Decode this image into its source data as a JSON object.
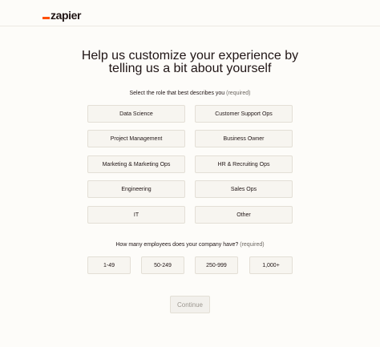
{
  "logo": {
    "text": "zapier"
  },
  "title": {
    "line1": "Help us customize your experience by",
    "line2": "telling us a bit about yourself"
  },
  "role_question": {
    "label": "Select the role that best describes you",
    "required": "(required)",
    "options": [
      "Data Science",
      "Customer Support Ops",
      "Project Management",
      "Business Owner",
      "Marketing & Marketing Ops",
      "HR & Recruiting Ops",
      "Engineering",
      "Sales Ops",
      "IT",
      "Other"
    ]
  },
  "employees_question": {
    "label": "How many employees does your company have?",
    "required": "(required)",
    "options": [
      "1-49",
      "50-249",
      "250-999",
      "1,000+"
    ]
  },
  "continue_label": "Continue",
  "colors": {
    "brand_orange": "#ff4f00",
    "text": "#201515",
    "background": "#fdfcf9",
    "option_bg": "#f7f5f0"
  }
}
